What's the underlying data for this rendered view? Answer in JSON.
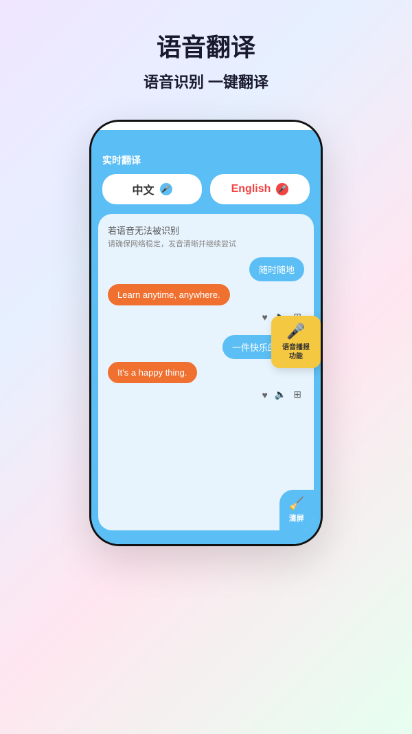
{
  "header": {
    "main_title": "语音翻译",
    "sub_title": "语音识别 一键翻译"
  },
  "phone": {
    "app_title": "实时翻译",
    "lang_left": {
      "label": "中文",
      "mic_type": "blue"
    },
    "lang_right": {
      "label": "English",
      "mic_type": "red"
    },
    "error": {
      "title": "若语音无法被识别",
      "subtitle": "请确保网络稳定，发音清晰并继续尝试"
    },
    "messages": [
      {
        "right_bubble": "随时随地",
        "left_bubble": "Learn anytime, anywhere."
      },
      {
        "right_bubble": "一件快乐的事。",
        "left_bubble": "It's a happy thing."
      }
    ],
    "tooltip": {
      "label": "语音播报功能"
    },
    "clear_btn": "清屏"
  }
}
